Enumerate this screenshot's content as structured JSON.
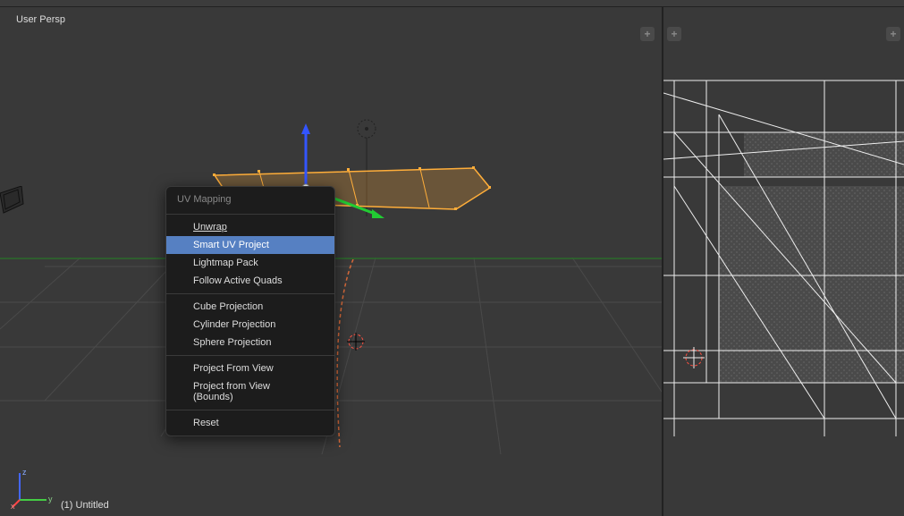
{
  "topbar": {},
  "viewport3d": {
    "view_label": "User Persp",
    "status": "(1) Untitled",
    "axis_labels": {
      "x": "x",
      "y": "y",
      "z": "z"
    }
  },
  "context_menu": {
    "title": "UV Mapping",
    "items": [
      {
        "label": "Unwrap",
        "underline_index": 0
      },
      {
        "label": "Smart UV Project",
        "underline_index": 0,
        "highlighted": true
      },
      {
        "label": "Lightmap Pack",
        "underline_index": 0
      },
      {
        "label": "Follow Active Quads",
        "underline_index": 0
      }
    ],
    "items2": [
      {
        "label": "Cube Projection",
        "underline_index": 0
      },
      {
        "label": "Cylinder Projection",
        "underline_index": 9
      },
      {
        "label": "Sphere Projection"
      }
    ],
    "items3": [
      {
        "label": "Project From View"
      },
      {
        "label": "Project from View (Bounds)",
        "underline_index": 19
      }
    ],
    "items4": [
      {
        "label": "Reset",
        "underline_index": 0
      }
    ]
  },
  "uv_editor": {}
}
